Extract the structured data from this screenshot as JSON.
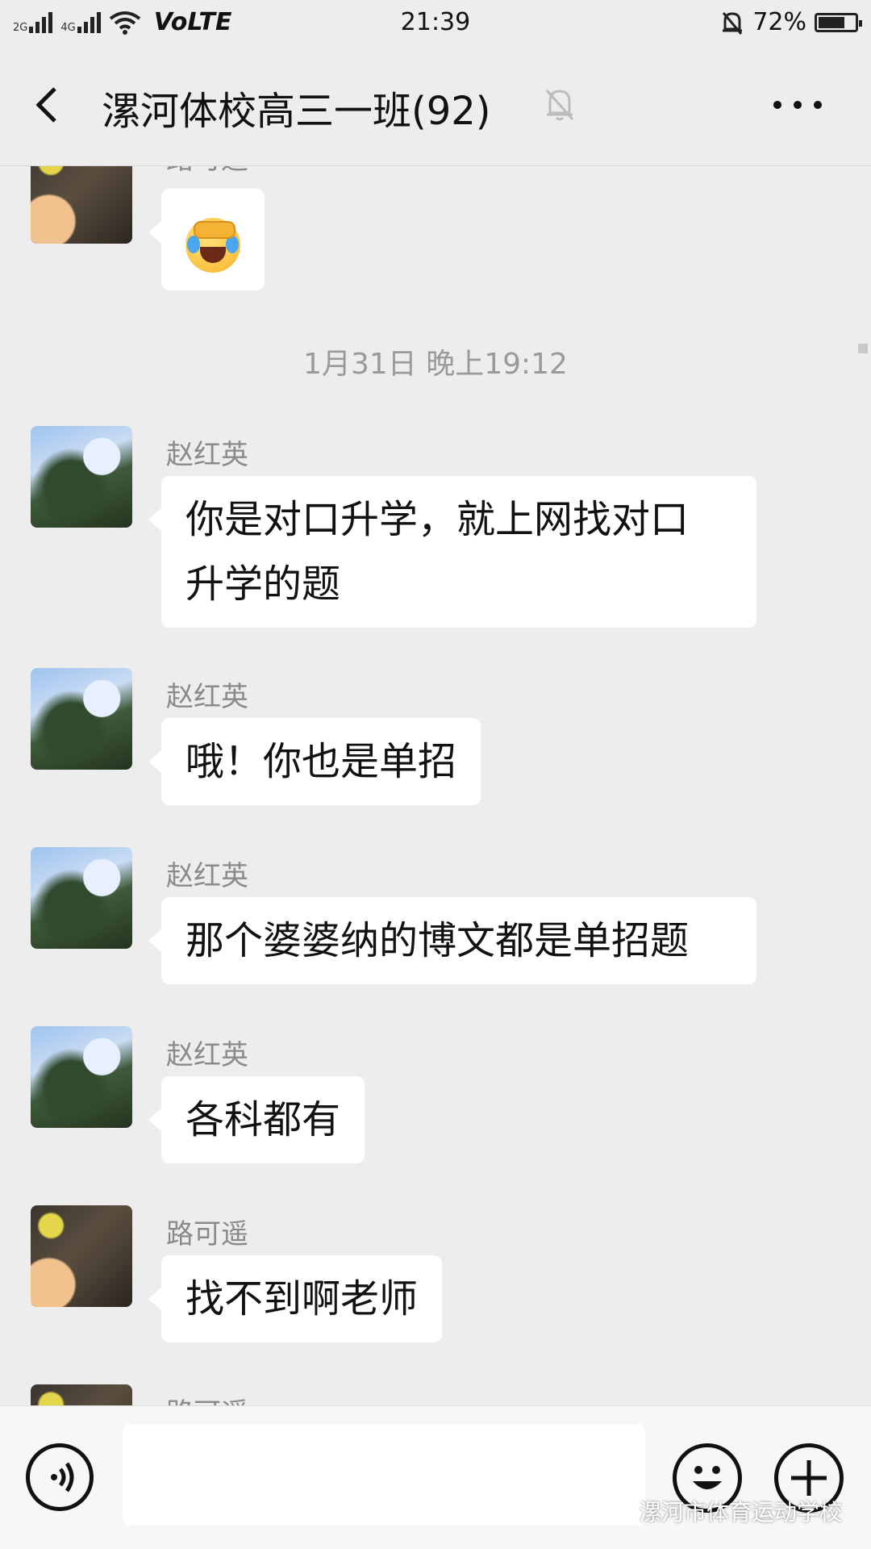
{
  "status_bar": {
    "network_1": "2G",
    "network_2": "4G",
    "carrier_tag": "VoLTE",
    "time": "21:39",
    "battery_percent": "72%",
    "battery_level": 0.72
  },
  "header": {
    "title": "漯河体校高三一班(92)",
    "back_icon": "chevron-left-icon",
    "mute_icon": "bell-off-icon",
    "more_icon": "more-dots-icon"
  },
  "chat": {
    "top_partial": {
      "sender": "路可遥",
      "emoji": "face-palm-laughing-emoji"
    },
    "timestamp": "1月31日 晚上19:12",
    "messages": [
      {
        "sender": "赵红英",
        "text_line1": "你是对口升学，就上网找对口",
        "text_line2": "升学的题"
      },
      {
        "sender": "赵红英",
        "text": "哦！你也是单招"
      },
      {
        "sender": "赵红英",
        "text": "那个婆婆纳的博文都是单招题"
      },
      {
        "sender": "赵红英",
        "text": "各科都有"
      },
      {
        "sender": "路可遥",
        "text": "找不到啊老师"
      }
    ],
    "bottom_partial": {
      "sender": "路可遥"
    }
  },
  "bottom_bar": {
    "voice_icon": "voice-input-icon",
    "emoji_icon": "smiley-icon",
    "plus_icon": "plus-icon",
    "input_value": ""
  },
  "watermark": {
    "text": "漯河市体育运动学校",
    "icon": "wechat-icon"
  }
}
